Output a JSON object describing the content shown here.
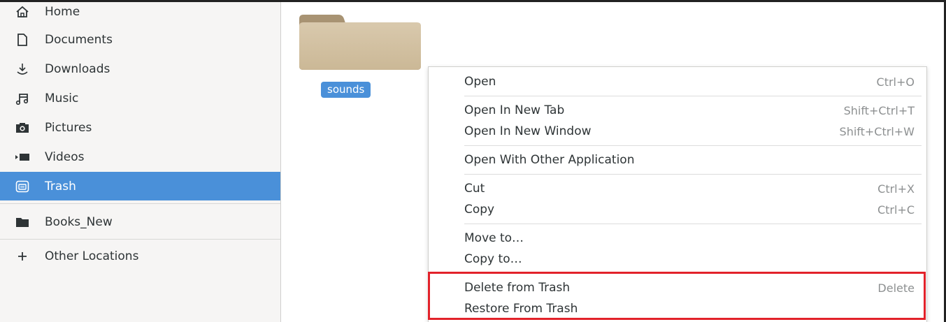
{
  "sidebar": {
    "items": [
      {
        "label": "Home",
        "icon": "home-icon"
      },
      {
        "label": "Documents",
        "icon": "document-icon"
      },
      {
        "label": "Downloads",
        "icon": "download-icon"
      },
      {
        "label": "Music",
        "icon": "music-icon"
      },
      {
        "label": "Pictures",
        "icon": "camera-icon"
      },
      {
        "label": "Videos",
        "icon": "video-icon"
      },
      {
        "label": "Trash",
        "icon": "trash-icon",
        "active": true
      }
    ],
    "bookmarks": [
      {
        "label": "Books_New",
        "icon": "folder-icon"
      }
    ],
    "other_locations": {
      "label": "Other Locations",
      "icon": "plus-icon"
    }
  },
  "content": {
    "file": {
      "name": "sounds",
      "icon": "folder-icon"
    }
  },
  "context_menu": {
    "items": [
      {
        "label": "Open",
        "shortcut": "Ctrl+O"
      },
      {
        "label": "Open In New Tab",
        "shortcut": "Shift+Ctrl+T"
      },
      {
        "label": "Open In New Window",
        "shortcut": "Shift+Ctrl+W"
      },
      {
        "label": "Open With Other Application",
        "shortcut": ""
      },
      {
        "label": "Cut",
        "shortcut": "Ctrl+X"
      },
      {
        "label": "Copy",
        "shortcut": "Ctrl+C"
      },
      {
        "label": "Move to…",
        "shortcut": ""
      },
      {
        "label": "Copy to…",
        "shortcut": ""
      },
      {
        "label": "Delete from Trash",
        "shortcut": "Delete"
      },
      {
        "label": "Restore From Trash",
        "shortcut": ""
      }
    ]
  },
  "colors": {
    "accent": "#4a90d9",
    "highlight_box": "#e2222a"
  }
}
